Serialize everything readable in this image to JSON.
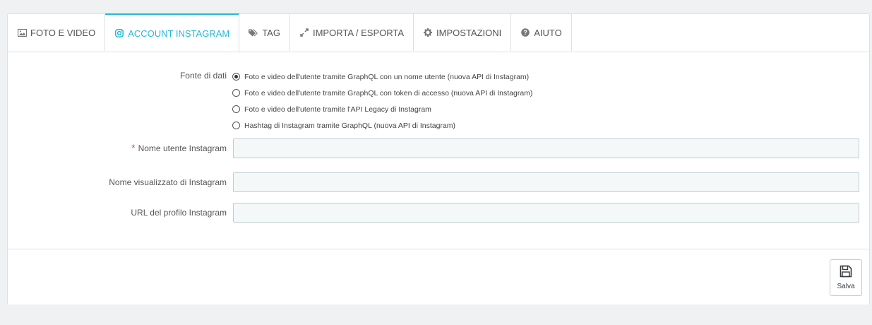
{
  "tabs": [
    {
      "label": "FOTO E VIDEO",
      "icon": "image-icon",
      "active": false
    },
    {
      "label": "ACCOUNT INSTAGRAM",
      "icon": "instagram-icon",
      "active": true
    },
    {
      "label": "TAG",
      "icon": "tags-icon",
      "active": false
    },
    {
      "label": "IMPORTA / ESPORTA",
      "icon": "import-export-icon",
      "active": false
    },
    {
      "label": "IMPOSTAZIONI",
      "icon": "gear-icon",
      "active": false
    },
    {
      "label": "AIUTO",
      "icon": "help-icon",
      "active": false
    }
  ],
  "form": {
    "data_source_label": "Fonte di dati",
    "data_source_options": [
      {
        "label": "Foto e video dell'utente tramite GraphQL con un nome utente (nuova API di Instagram)",
        "checked": true
      },
      {
        "label": "Foto e video dell'utente tramite GraphQL con token di accesso (nuova API di Instagram)",
        "checked": false
      },
      {
        "label": "Foto e video dell'utente tramite l'API Legacy di Instagram",
        "checked": false
      },
      {
        "label": "Hashtag di Instagram tramite GraphQL (nuova API di Instagram)",
        "checked": false
      }
    ],
    "username_required_mark": "*",
    "username_label": "Nome utente Instagram",
    "username_value": "",
    "display_name_label": "Nome visualizzato di Instagram",
    "display_name_value": "",
    "profile_url_label": "URL del profilo Instagram",
    "profile_url_value": ""
  },
  "footer": {
    "save_label": "Salva",
    "save_icon": "floppy-disk-icon"
  },
  "colors": {
    "accent": "#25b9d7",
    "required": "#e84e4e",
    "background": "#eff1f2"
  }
}
